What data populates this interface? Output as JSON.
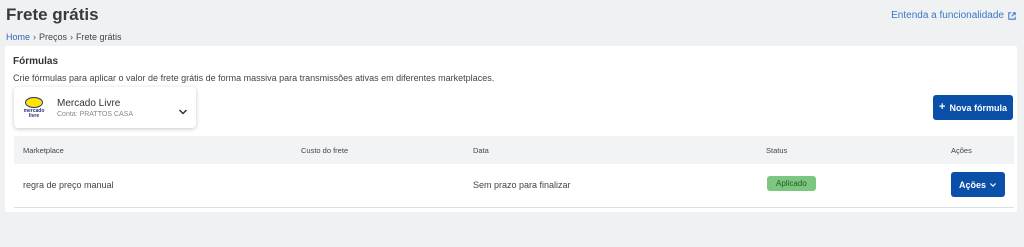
{
  "header": {
    "title": "Frete grátis",
    "help_link": "Entenda a funcionalidade",
    "help_icon": "external-link-icon"
  },
  "breadcrumb": {
    "items": [
      "Home",
      "Preços",
      "Frete grátis"
    ]
  },
  "section": {
    "title": "Fórmulas",
    "description": "Crie fórmulas para aplicar o valor de frete grátis de forma massiva para transmissões ativas em diferentes marketplaces."
  },
  "marketplace_select": {
    "logo_text": "mercado livre",
    "name": "Mercado Livre",
    "account": "Conta: PRATTOS CASA",
    "icon": "chevron-down-icon"
  },
  "new_formula_button": {
    "label": "Nova fórmula",
    "icon": "plus-icon"
  },
  "table": {
    "columns": [
      "Marketplace",
      "Custo do frete",
      "Data",
      "Status",
      "Ações"
    ],
    "rows": [
      {
        "marketplace": "regra de preço manual",
        "shipping_cost": "",
        "date": "Sem prazo para finalizar",
        "status": "Aplicado",
        "action_label": "Ações"
      }
    ]
  },
  "colors": {
    "primary": "#0a4fa8",
    "link": "#3a78c4",
    "status_applied": "#7dc67f",
    "background": "#eff1f3"
  }
}
